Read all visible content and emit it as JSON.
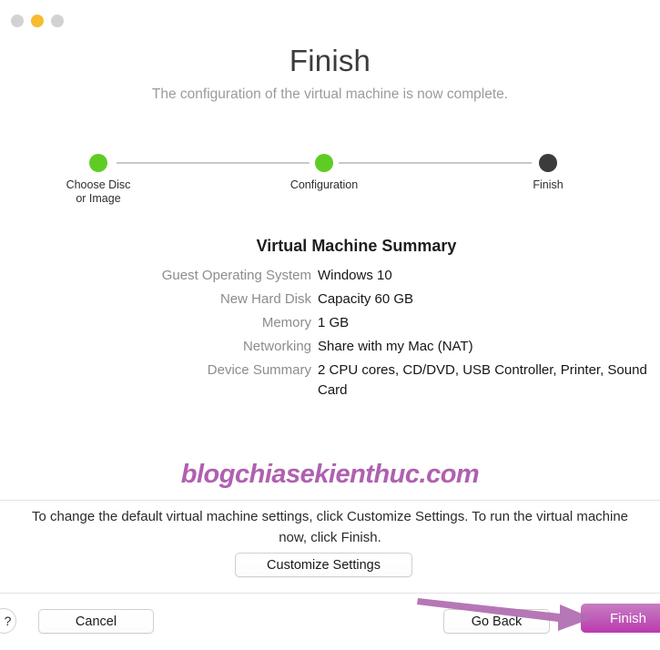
{
  "window": {
    "traffic_lights": [
      {
        "name": "close",
        "color": "#d2d2d2"
      },
      {
        "name": "minimize",
        "color": "#f6bc2f"
      },
      {
        "name": "zoom",
        "color": "#d2d2d2"
      }
    ]
  },
  "header": {
    "title": "Finish",
    "subtitle": "The configuration of the virtual machine is now complete."
  },
  "stepper": {
    "steps": [
      {
        "label": "Choose Disc\nor Image",
        "state": "done",
        "color": "#5fcc26"
      },
      {
        "label": "Configuration",
        "state": "done",
        "color": "#5fcc26"
      },
      {
        "label": "Finish",
        "state": "current",
        "color": "#3b3b3b"
      }
    ]
  },
  "summary": {
    "title": "Virtual Machine Summary",
    "rows": [
      {
        "label": "Guest Operating System",
        "value": "Windows 10"
      },
      {
        "label": "New Hard Disk",
        "value": "Capacity 60 GB"
      },
      {
        "label": "Memory",
        "value": "1 GB"
      },
      {
        "label": "Networking",
        "value": "Share with my Mac (NAT)"
      },
      {
        "label": "Device Summary",
        "value": "2 CPU cores, CD/DVD, USB Controller, Printer, Sound Card"
      }
    ]
  },
  "watermark": {
    "text": "blogchiasekienthuc.com",
    "color": "#b060b0"
  },
  "hint": {
    "text": "To change the default virtual machine settings, click Customize Settings. To run the virtual machine now, click Finish."
  },
  "buttons": {
    "customize": "Customize Settings",
    "help": "?",
    "cancel": "Cancel",
    "go_back": "Go Back",
    "finish": "Finish",
    "finish_color": "#bc38b0"
  },
  "annotation": {
    "arrow_color": "#b06bb0",
    "points_to": "Finish"
  }
}
